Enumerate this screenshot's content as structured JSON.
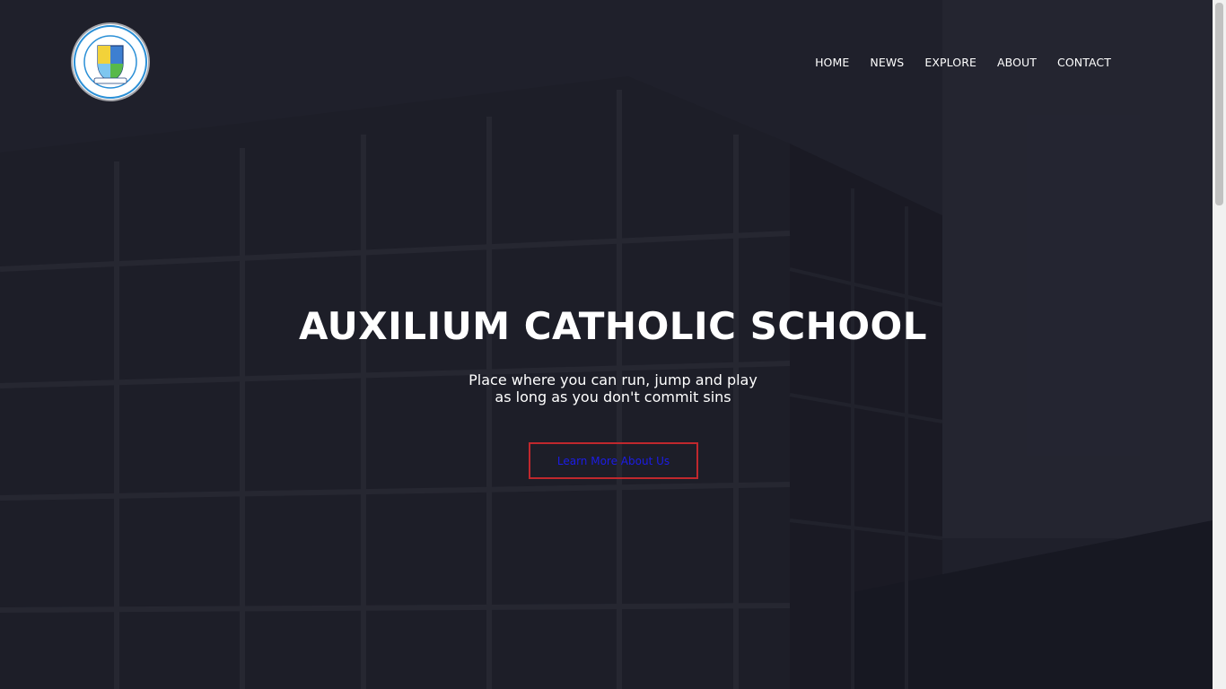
{
  "logo": {
    "top_text": "AUXILIUM CATHOLIC SCHOOL",
    "bottom_text": "HIGH VALUES FOR A BETTER FUTURE",
    "ribbon_text": "JOSTE ABABA"
  },
  "nav": {
    "items": [
      {
        "label": "HOME"
      },
      {
        "label": "NEWS"
      },
      {
        "label": "EXPLORE"
      },
      {
        "label": "ABOUT"
      },
      {
        "label": "CONTACT"
      }
    ]
  },
  "hero": {
    "title": "AUXILIUM CATHOLIC SCHOOL",
    "subtitle_line1": "Place where you can run, jump and play",
    "subtitle_line2": "as long as you don't commit sins",
    "cta_label": "Learn More About Us"
  },
  "colors": {
    "overlay": "#12121e",
    "cta_border": "#c0282d",
    "cta_text": "#1c1ce6",
    "text": "#ffffff"
  }
}
